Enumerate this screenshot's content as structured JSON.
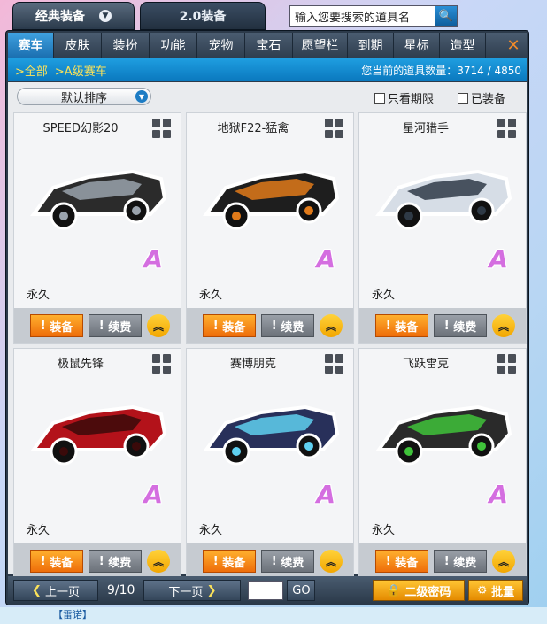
{
  "toptabs": {
    "classic": "经典装备",
    "v2": "2.0装备"
  },
  "search": {
    "placeholder": "输入您要搜索的道具名"
  },
  "categories": [
    "赛车",
    "皮肤",
    "装扮",
    "功能",
    "宠物",
    "宝石",
    "愿望栏",
    "到期",
    "星标",
    "造型"
  ],
  "crumb": {
    "all": ">全部",
    "sub": ">A级赛车",
    "count": "您当前的道具数量：3714 / 4850"
  },
  "sort": {
    "label": "默认排序"
  },
  "filters": {
    "expiring": "只看期限",
    "equipped": "已装备"
  },
  "cards": [
    {
      "name": "SPEED幻影20",
      "grade": "A",
      "duration": "永久",
      "color": "#2b2b2b",
      "accent": "#9aa3ad"
    },
    {
      "name": "地狱F22-猛禽",
      "grade": "A",
      "duration": "永久",
      "color": "#1e1e1e",
      "accent": "#e07a1a"
    },
    {
      "name": "星河猎手",
      "grade": "A",
      "duration": "永久",
      "color": "#d6dde6",
      "accent": "#2f3a46"
    },
    {
      "name": "极鼠先锋",
      "grade": "A",
      "duration": "永久",
      "color": "#b3121a",
      "accent": "#3a0a0a"
    },
    {
      "name": "赛博朋克",
      "grade": "A",
      "duration": "永久",
      "color": "#28305a",
      "accent": "#5fd0f0"
    },
    {
      "name": "飞跃雷克",
      "grade": "A",
      "duration": "永久",
      "color": "#2a2a2a",
      "accent": "#3fc23a"
    }
  ],
  "buttons": {
    "equip": "装备",
    "renew": "续费",
    "prev": "上一页",
    "next": "下一页",
    "go": "GO",
    "password": "二级密码",
    "batch": "批量"
  },
  "page": "9/10",
  "chat": "【雷诺】"
}
